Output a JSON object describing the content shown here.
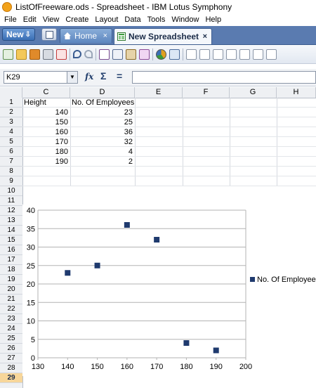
{
  "window": {
    "title": "ListOfFreeware.ods - Spreadsheet - IBM Lotus Symphony"
  },
  "menu": [
    "File",
    "Edit",
    "View",
    "Create",
    "Layout",
    "Data",
    "Tools",
    "Window",
    "Help"
  ],
  "tabs": {
    "new_label": "New",
    "home_label": "Home",
    "sheet_label": "New Spreadsheet",
    "close_glyph": "×"
  },
  "formula_bar": {
    "name_box": "K29",
    "sum_glyph": "Σ",
    "equals_glyph": "="
  },
  "columns": [
    "C",
    "D",
    "E",
    "F",
    "G",
    "H"
  ],
  "rows": [
    "1",
    "2",
    "3",
    "4",
    "5",
    "6",
    "7",
    "8",
    "9",
    "10",
    "11",
    "12",
    "13",
    "14",
    "15",
    "16",
    "17",
    "18",
    "19",
    "20",
    "21",
    "22",
    "23",
    "24",
    "25",
    "26",
    "27",
    "28",
    "29"
  ],
  "active_row": "29",
  "table": {
    "header_height": "Height",
    "header_employees": "No. Of Employees",
    "heights": [
      "140",
      "150",
      "160",
      "170",
      "180",
      "190"
    ],
    "employees": [
      "23",
      "25",
      "36",
      "32",
      "4",
      "2"
    ]
  },
  "chart_data": {
    "type": "scatter",
    "series": [
      {
        "name": "No. Of Employees",
        "x": [
          140,
          150,
          160,
          170,
          180,
          190
        ],
        "y": [
          23,
          25,
          36,
          32,
          4,
          2
        ],
        "color": "#1f3a6e"
      }
    ],
    "xlim": [
      130,
      200
    ],
    "ylim": [
      0,
      40
    ],
    "x_ticks": [
      130,
      140,
      150,
      160,
      170,
      180,
      190,
      200
    ],
    "y_ticks": [
      0,
      5,
      10,
      15,
      20,
      25,
      30,
      35,
      40
    ],
    "grid": "horizontal",
    "legend": "right"
  }
}
